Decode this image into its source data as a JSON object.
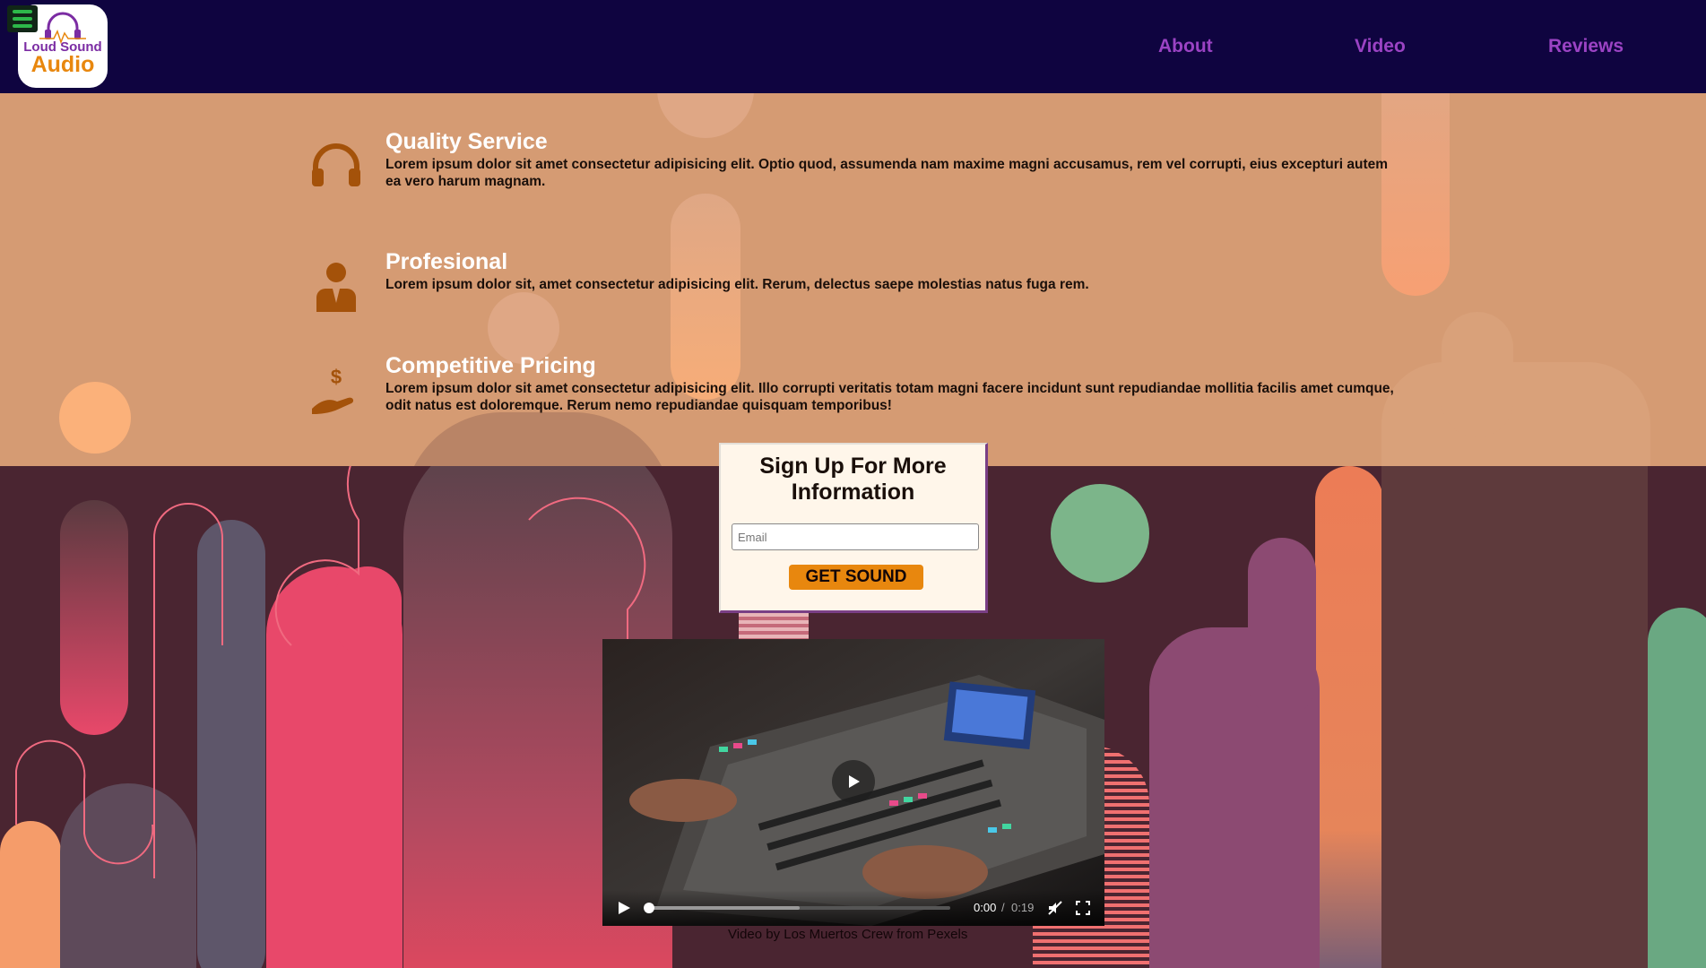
{
  "nav": {
    "logo_line1": "Loud Sound",
    "logo_line2": "Audio",
    "links": [
      "About",
      "Video",
      "Reviews"
    ]
  },
  "features": [
    {
      "icon": "headphones-icon",
      "title": "Quality Service",
      "text": "Lorem ipsum dolor sit amet consectetur adipisicing elit. Optio quod, assumenda nam maxime magni accusamus, rem vel corrupti, eius excepturi autem ea vero harum magnam."
    },
    {
      "icon": "businessman-icon",
      "title": "Profesional",
      "text": "Lorem ipsum dolor sit, amet consectetur adipisicing elit. Rerum, delectus saepe molestias natus fuga rem."
    },
    {
      "icon": "hand-dollar-icon",
      "title": "Competitive Pricing",
      "text": "Lorem ipsum dolor sit amet consectetur adipisicing elit. Illo corrupti veritatis totam magni facere incidunt sunt repudiandae mollitia facilis amet cumque, odit natus est doloremque. Rerum nemo repudiandae quisquam temporibus!"
    }
  ],
  "signup": {
    "title": "Sign Up For More Information",
    "email_placeholder": "Email",
    "button_label": "GET SOUND"
  },
  "video": {
    "current_time": "0:00",
    "separator": "/",
    "duration": "0:19",
    "progress": 0.0,
    "caption": "Video by Los Muertos Crew from Pexels"
  },
  "colors": {
    "nav_bg": "#0f0440",
    "nav_link": "#9b43c4",
    "hero_bg": "#d59b73",
    "bottom_bg": "#4a2531",
    "accent_orange": "#e8870e",
    "feature_icon": "#a4520a"
  }
}
